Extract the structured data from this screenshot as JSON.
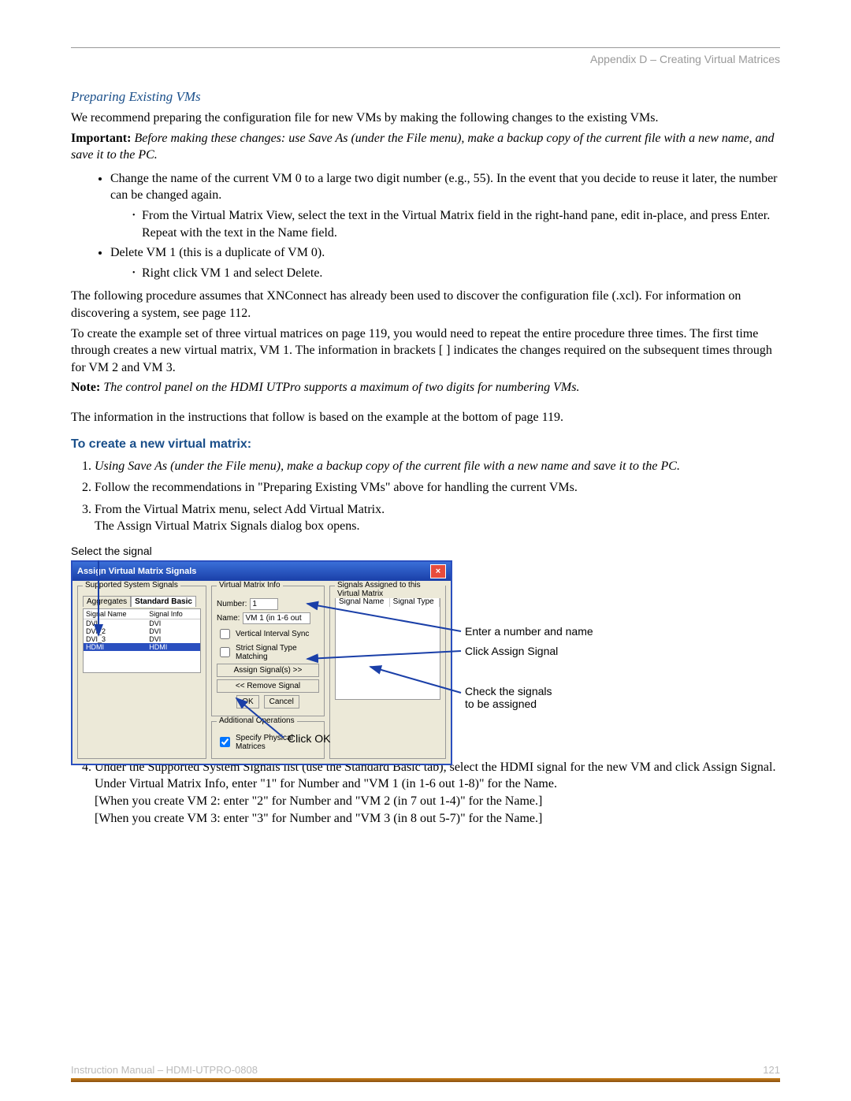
{
  "header": "Appendix D – Creating Virtual Matrices",
  "h_prep": "Preparing Existing VMs",
  "p1": "We recommend preparing the configuration file for new VMs by making the following changes to the existing VMs.",
  "imp_b": "Important:",
  "imp": " Before making these changes: use Save As (under the File menu), make a backup copy of the current file with a new name, and save it to the PC.",
  "b1": "Change the name of the current VM 0 to a large two digit number (e.g., 55). In the event that you decide to reuse it later, the number can be changed again.",
  "b1a": "From the Virtual Matrix View, select the text in the Virtual Matrix field in the right-hand pane, edit in-place, and press Enter. Repeat with the text in the Name field.",
  "b2": "Delete VM 1 (this is a duplicate of VM 0).",
  "b2a": "Right click VM 1 and select Delete.",
  "p2": "The following procedure assumes that XNConnect has already been used to discover the configuration file (.xcl). For information on discovering a system, see page 112.",
  "p3": "To create the example set of three virtual matrices on page 119, you would need to repeat the entire procedure three times. The first time through creates a new virtual matrix, VM 1. The information in brackets [ ] indicates the changes required on the subsequent times through for VM 2 and VM 3.",
  "note_b": "Note:",
  "note": " The control panel on the HDMI UTPro supports a maximum of two digits for numbering VMs.",
  "p4": "The information in the instructions that follow is based on the example at the bottom of page 119.",
  "h_create": "To create a new virtual matrix:",
  "s1": "Using Save As (under the File menu), make a backup copy of the current file with a new name and save it to the PC.",
  "s2": "Follow the recommendations in \"Preparing Existing VMs\" above for handling the current VMs.",
  "s3a": "From the Virtual Matrix menu, select Add Virtual Matrix.",
  "s3b": "The Assign Virtual Matrix Signals dialog box opens.",
  "sel": "Select the signal",
  "dlg": {
    "title": "Assign Virtual Matrix Signals",
    "g1": "Supported System Signals",
    "g2": "Virtual Matrix Info",
    "g3": "Signals Assigned to this Virtual Matrix",
    "g4": "Additional Operations",
    "tab_agg": "Aggregates",
    "tab_std": "Standard Basic",
    "col_sn": "Signal Name",
    "col_si": "Signal Info",
    "col_st": "Signal Type",
    "r1": "DVI",
    "r2": "DVI_2",
    "r3": "DVI_3",
    "r4": "HDMI",
    "ri": "DVI",
    "rh": "HDMI",
    "lbl_num": "Number:",
    "val_num": "1",
    "lbl_name": "Name:",
    "val_name": "VM 1 (in 1-6 out",
    "chk_vis": "Vertical Interval Sync",
    "chk_strict": "Strict Signal Type Matching",
    "btn_assign": "Assign Signal(s) >>",
    "btn_remove": "<< Remove Signal",
    "btn_ok": "OK",
    "btn_cancel": "Cancel",
    "chk_spm": "Specify Physical Matrices"
  },
  "c1": "Enter a number and name",
  "c2": "Click Assign Signal",
  "c3a": "Check the signals",
  "c3b": "to be assigned",
  "c4": "Click OK",
  "s4a": "Under the Supported System Signals list (use the Standard Basic tab), select the HDMI signal for the new VM and click Assign Signal.",
  "s4b": "Under Virtual Matrix Info, enter \"1\" for Number and \"VM 1 (in 1-6 out 1-8)\" for the Name.",
  "s4c": "[When you create VM 2: enter \"2\" for Number and \"VM 2 (in 7 out 1-4)\" for the Name.]",
  "s4d": "[When you create VM 3: enter \"3\" for Number and \"VM 3 (in 8 out 5-7)\" for the Name.]",
  "foot_l": "Instruction Manual – HDMI-UTPRO-0808",
  "foot_r": "121"
}
